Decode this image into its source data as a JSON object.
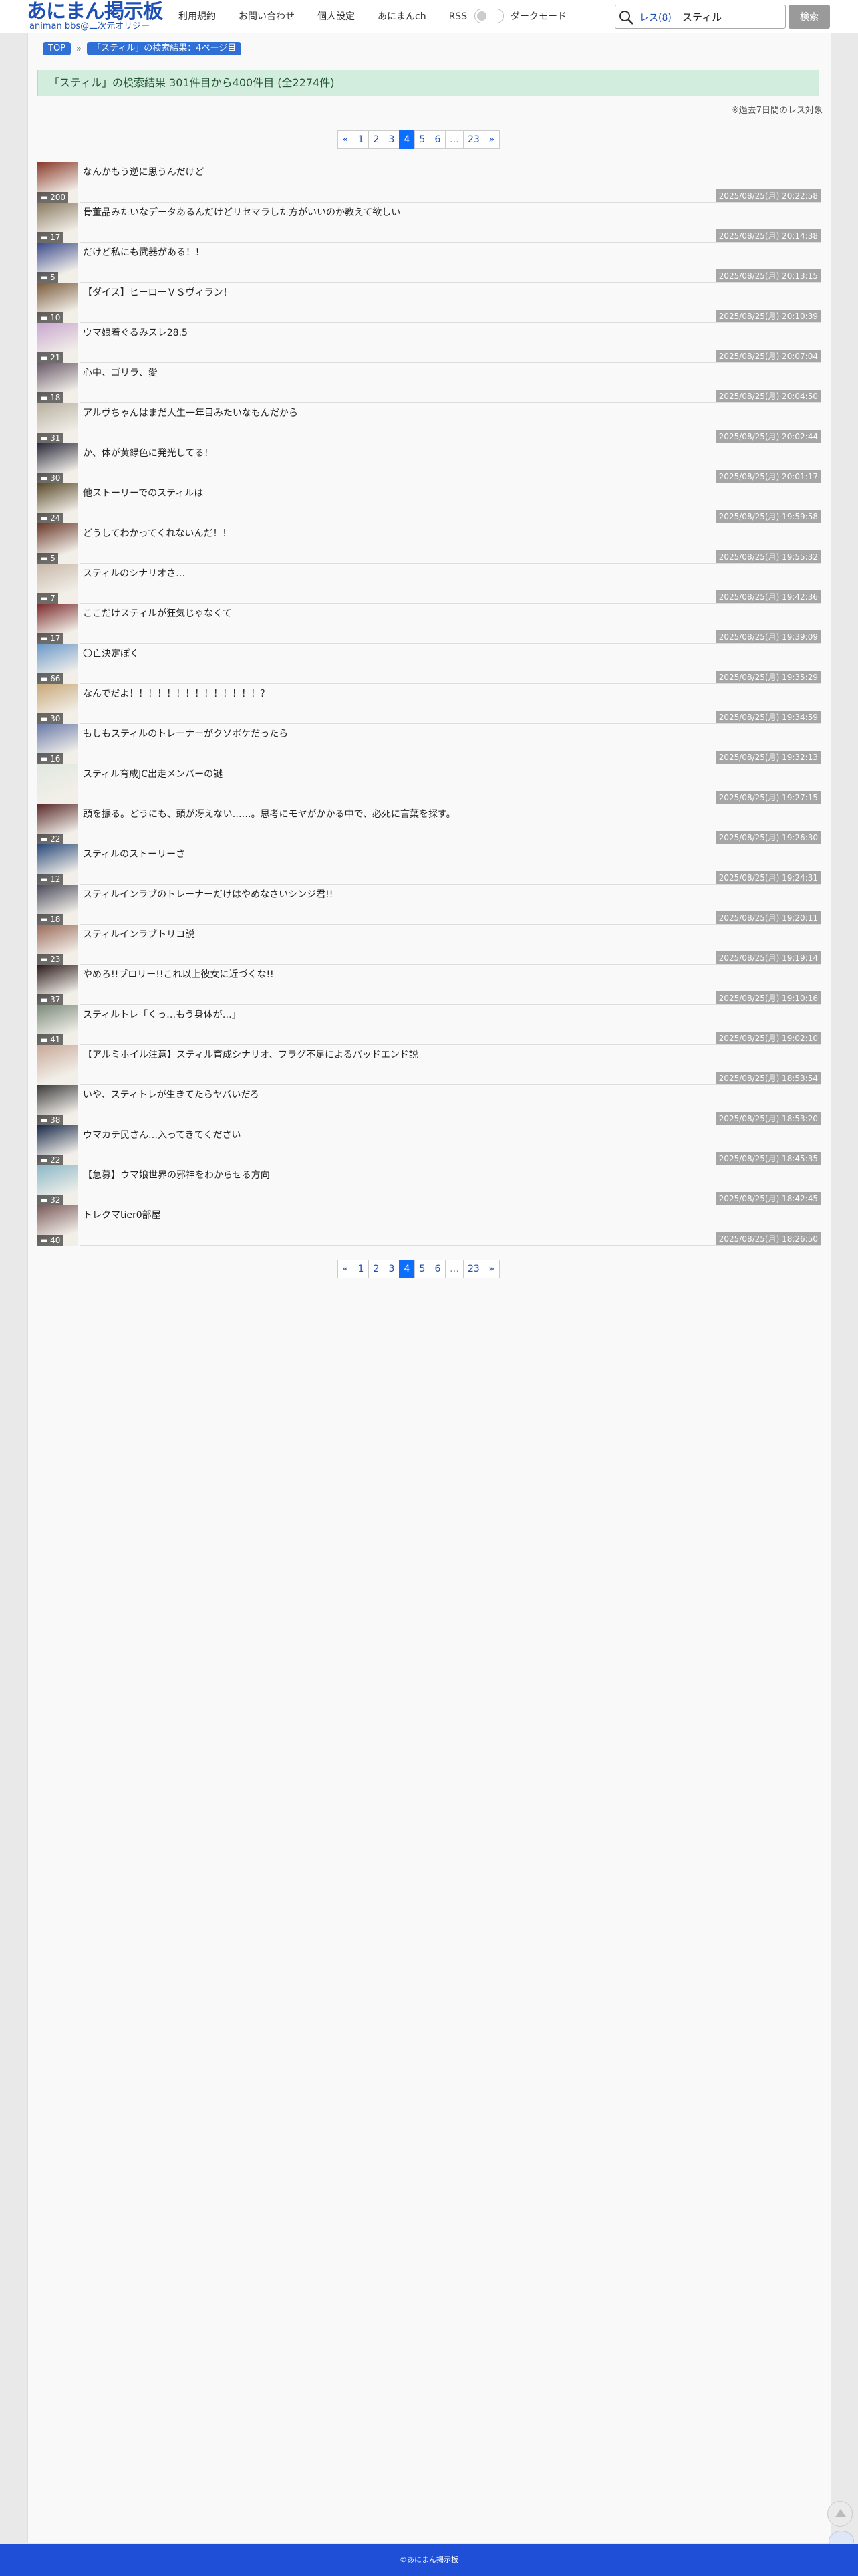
{
  "header": {
    "logo_main": "あにまん掲示板",
    "logo_sub": "animan bbs@二次元オリジー",
    "nav": [
      "利用規約",
      "お問い合わせ",
      "個人設定",
      "あにまんch",
      "RSS"
    ],
    "dark_mode_label": "ダークモード",
    "search_scope": "レス(8)",
    "search_value": "スティル",
    "search_button": "検索"
  },
  "breadcrumb": {
    "top": "TOP",
    "separator": "»",
    "current": "「スティル」の検索結果：4ページ目"
  },
  "result_banner": "「スティル」の検索結果 301件目から400件目 (全2274件)",
  "note": "※過去7日間のレス対象",
  "pagination": {
    "prev": "«",
    "pages": [
      "1",
      "2",
      "3",
      "4",
      "5",
      "6"
    ],
    "active": "4",
    "dots": "…",
    "last": "23",
    "next": "»"
  },
  "threads": [
    {
      "title": "なんかもう逆に思うんだけど",
      "count": "200",
      "date": "2025/08/25(月) 20:22:58"
    },
    {
      "title": "骨董品みたいなデータあるんだけどリセマラした方がいいのか教えて欲しい",
      "count": "17",
      "date": "2025/08/25(月) 20:14:38"
    },
    {
      "title": "だけど私にも武器がある！！",
      "count": "5",
      "date": "2025/08/25(月) 20:13:15"
    },
    {
      "title": "【ダイス】ヒーローＶＳヴィラン！",
      "count": "10",
      "date": "2025/08/25(月) 20:10:39"
    },
    {
      "title": "ウマ娘着ぐるみスレ28.5",
      "count": "21",
      "date": "2025/08/25(月) 20:07:04"
    },
    {
      "title": "心中、ゴリラ、愛",
      "count": "18",
      "date": "2025/08/25(月) 20:04:50"
    },
    {
      "title": "アルヴちゃんはまだ人生一年目みたいなもんだから",
      "count": "31",
      "date": "2025/08/25(月) 20:02:44"
    },
    {
      "title": "か、体が黄緑色に発光してる！",
      "count": "30",
      "date": "2025/08/25(月) 20:01:17"
    },
    {
      "title": "他ストーリーでのスティルは",
      "count": "24",
      "date": "2025/08/25(月) 19:59:58"
    },
    {
      "title": "どうしてわかってくれないんだ！！",
      "count": "5",
      "date": "2025/08/25(月) 19:55:32"
    },
    {
      "title": "スティルのシナリオさ…",
      "count": "7",
      "date": "2025/08/25(月) 19:42:36"
    },
    {
      "title": "ここだけスティルが狂気じゃなくて",
      "count": "17",
      "date": "2025/08/25(月) 19:39:09"
    },
    {
      "title": "〇亡決定ぽく",
      "count": "66",
      "date": "2025/08/25(月) 19:35:29"
    },
    {
      "title": "なんでだよ！！！！！！！！！！！！！！？",
      "count": "30",
      "date": "2025/08/25(月) 19:34:59"
    },
    {
      "title": "もしもスティルのトレーナーがクソボケだったら",
      "count": "16",
      "date": "2025/08/25(月) 19:32:13"
    },
    {
      "title": "スティル育成JC出走メンバーの謎",
      "count": "",
      "date": "2025/08/25(月) 19:27:15"
    },
    {
      "title": "頭を振る。どうにも、頭が冴えない……。思考にモヤがかかる中で、必死に言葉を探す。",
      "count": "22",
      "date": "2025/08/25(月) 19:26:30"
    },
    {
      "title": "スティルのストーリーさ",
      "count": "12",
      "date": "2025/08/25(月) 19:24:31"
    },
    {
      "title": "スティルインラブのトレーナーだけはやめなさいシンジ君!!",
      "count": "18",
      "date": "2025/08/25(月) 19:20:11"
    },
    {
      "title": "スティルインラブトリコ説",
      "count": "23",
      "date": "2025/08/25(月) 19:19:14"
    },
    {
      "title": "やめろ!!ブロリー!!これ以上彼女に近づくな!!",
      "count": "37",
      "date": "2025/08/25(月) 19:10:16"
    },
    {
      "title": "スティルトレ「くっ…もう身体が…」",
      "count": "41",
      "date": "2025/08/25(月) 19:02:10"
    },
    {
      "title": "【アルミホイル注意】スティル育成シナリオ、フラグ不足によるバッドエンド説",
      "count": "",
      "date": "2025/08/25(月) 18:53:54"
    },
    {
      "title": "いや、スティトレが生きてたらヤバいだろ",
      "count": "38",
      "date": "2025/08/25(月) 18:53:20"
    },
    {
      "title": "ウマカテ民さん…入ってきてください",
      "count": "22",
      "date": "2025/08/25(月) 18:45:35"
    },
    {
      "title": "【急募】ウマ娘世界の邪神をわからせる方向",
      "count": "32",
      "date": "2025/08/25(月) 18:42:45"
    },
    {
      "title": "トレクマtier0部屋",
      "count": "40",
      "date": "2025/08/25(月) 18:26:50"
    }
  ],
  "thumb_colors": [
    "#8a3a2a",
    "#8a7a60",
    "#3a4a8a",
    "#7a5a3a",
    "#c8a7d0",
    "#6a5a6a",
    "#b8b0a0",
    "#2a2a3a",
    "#5a4a2a",
    "#6a3a2a",
    "#c8b8a8",
    "#7a2a2a",
    "#6a98c8",
    "#c8a878",
    "#6a7aa8",
    "#e0e8e0",
    "#5a2a2a",
    "#2a4a7a",
    "#4a4a5a",
    "#9a6a5a",
    "#2a1a1a",
    "#7a8a7a",
    "#c8a898",
    "#3a3a3a",
    "#1a2a4a",
    "#8ab8c8",
    "#7a5a5a"
  ],
  "footer": "©あにまん掲示板"
}
